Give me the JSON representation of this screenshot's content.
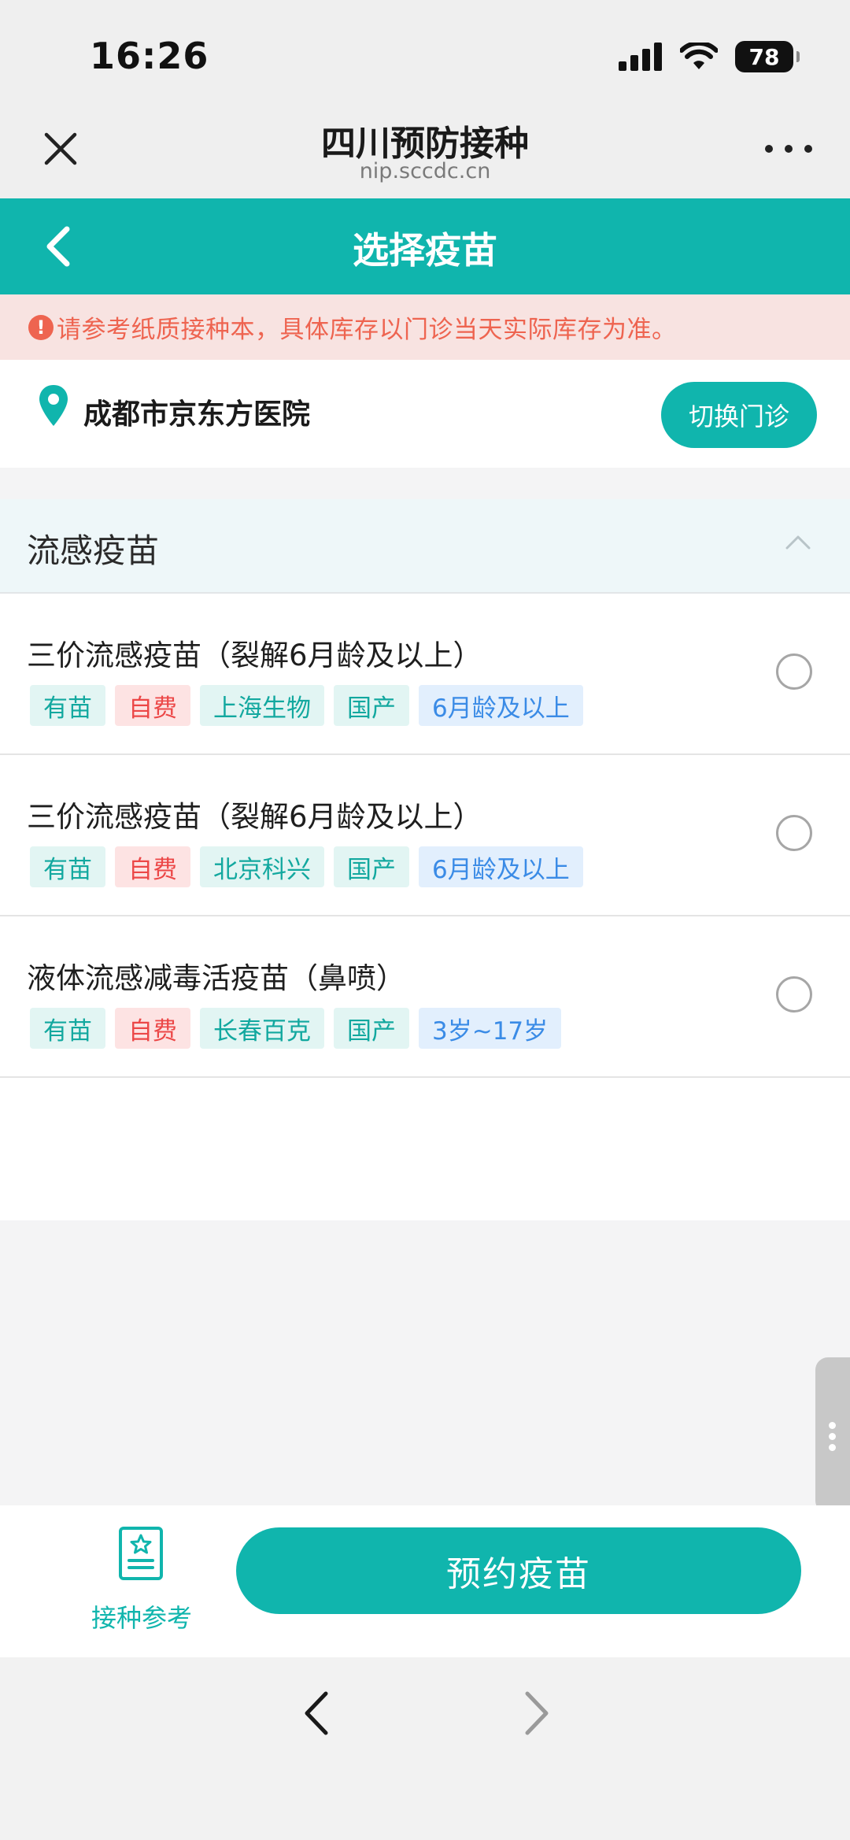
{
  "status_bar": {
    "time": "16:26",
    "battery": "78"
  },
  "browser": {
    "title": "四川预防接种",
    "url": "nip.sccdc.cn"
  },
  "header": {
    "title": "选择疫苗"
  },
  "notice": {
    "icon": "!",
    "text": "请参考纸质接种本，具体库存以门诊当天实际库存为准。"
  },
  "clinic": {
    "name": "成都市京东方医院",
    "switch_label": "切换门诊"
  },
  "section": {
    "title": "流感疫苗"
  },
  "vaccines": [
    {
      "name": "三价流感疫苗（裂解6月龄及以上）",
      "tags": [
        "有苗",
        "自费",
        "上海生物",
        "国产",
        "6月龄及以上"
      ]
    },
    {
      "name": "三价流感疫苗（裂解6月龄及以上）",
      "tags": [
        "有苗",
        "自费",
        "北京科兴",
        "国产",
        "6月龄及以上"
      ]
    },
    {
      "name": "液体流感减毒活疫苗（鼻喷）",
      "tags": [
        "有苗",
        "自费",
        "长春百克",
        "国产",
        "3岁~17岁"
      ]
    }
  ],
  "bottom": {
    "reference_label": "接种参考",
    "book_label": "预约疫苗"
  },
  "colors": {
    "primary": "#10b5ad",
    "notice_text": "#ee6450",
    "tag_red": "#ec4747",
    "tag_blue": "#3a8be6"
  },
  "icons": [
    "close-icon",
    "more-icon",
    "back-arrow-icon",
    "location-pin-icon",
    "chevron-up-icon",
    "radio-unchecked-icon",
    "reference-book-icon",
    "nav-back-icon",
    "nav-forward-icon"
  ]
}
